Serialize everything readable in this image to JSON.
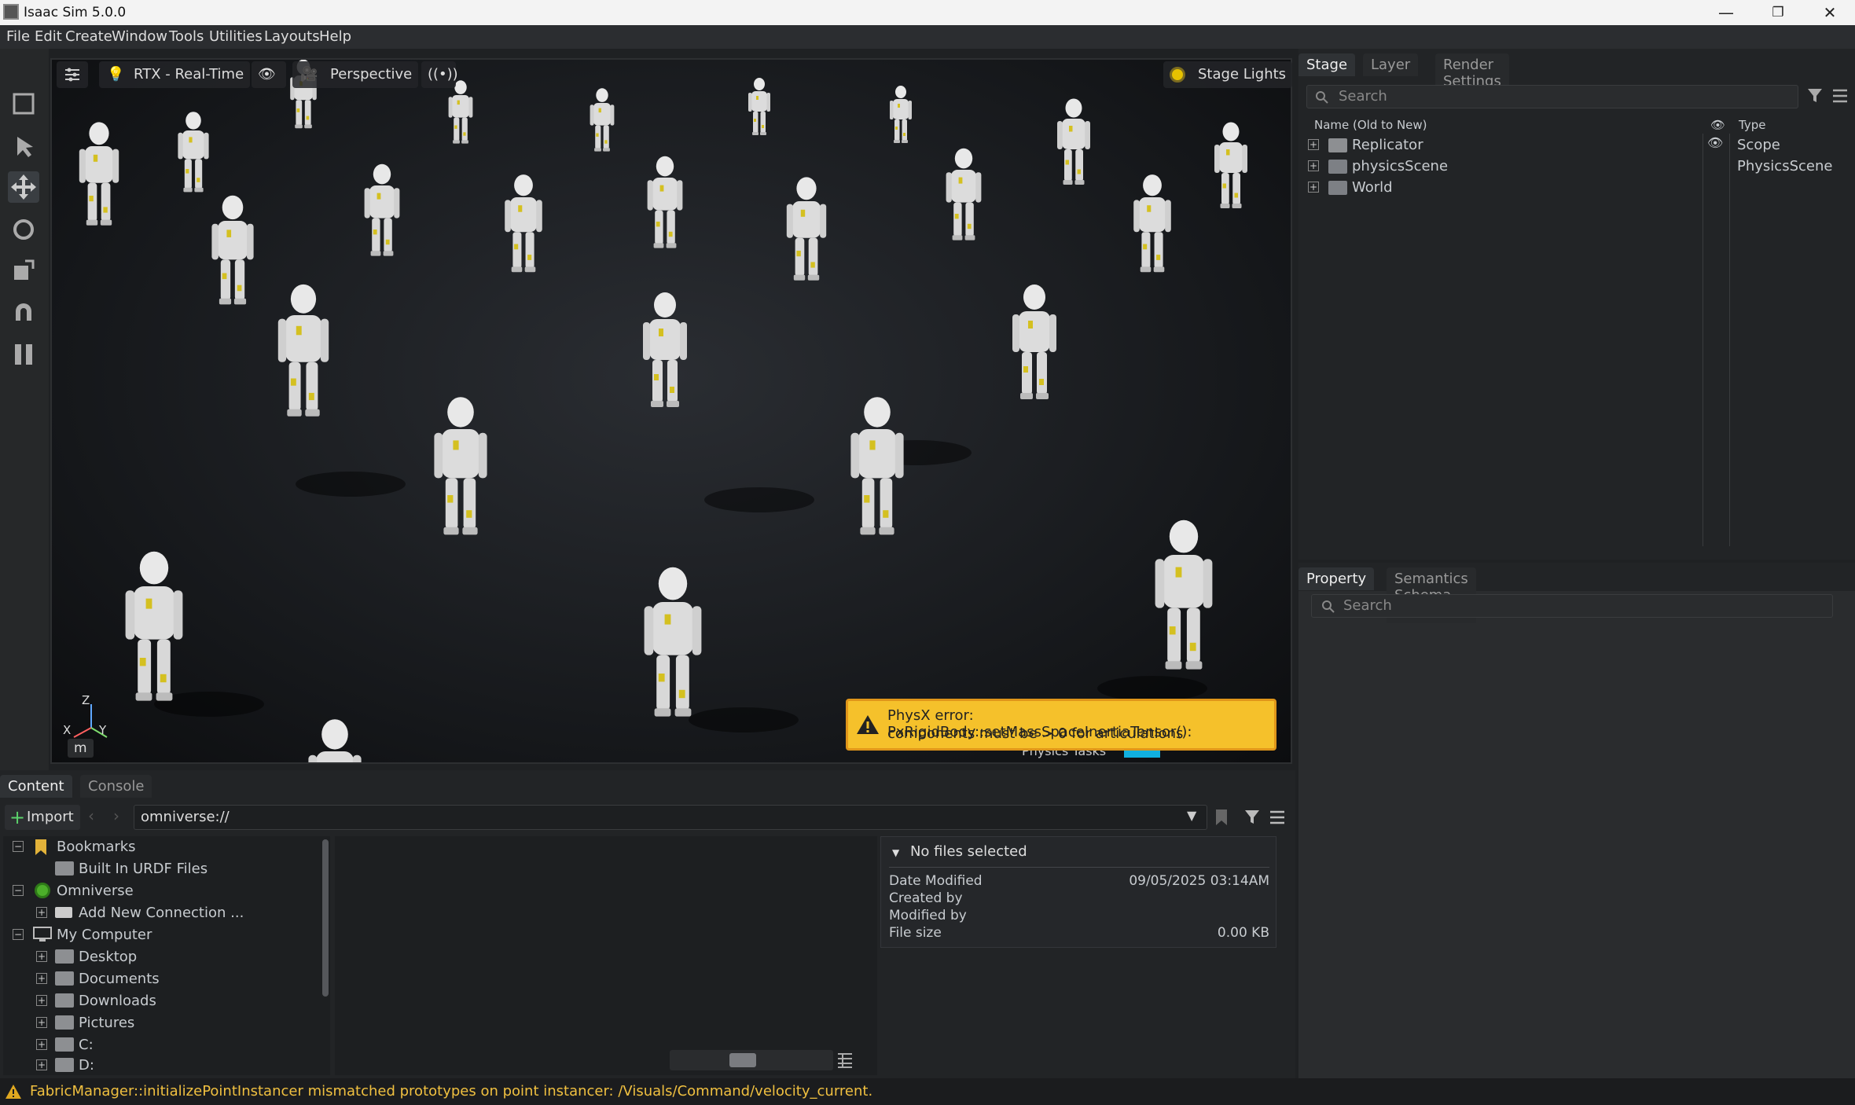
{
  "window": {
    "title": "Isaac Sim 5.0.0",
    "minimize": "—",
    "maximize": "❐",
    "close": "✕"
  },
  "menu": [
    "File",
    "Edit",
    "Create",
    "Window",
    "Tools",
    "Utilities",
    "Layouts",
    "Help"
  ],
  "viewport": {
    "render_mode": "RTX - Real-Time",
    "camera": "Perspective",
    "lights": "Stage Lights",
    "unit": "m",
    "axis_z": "Z",
    "axis_x": "X",
    "axis_y": "Y",
    "physics_tasks": "Physics Tasks",
    "warning": {
      "line1": "PhysX error: PxRigidBody::setMassSpaceInertiaTensor():",
      "line2": "components must be > 0 for articulations"
    }
  },
  "stage": {
    "tabs": [
      "Stage",
      "Layer",
      "Render Settings"
    ],
    "search_placeholder": "Search",
    "col_name": "Name (Old to New)",
    "col_type": "Type",
    "items": [
      {
        "name": "Replicator",
        "type": "Scope"
      },
      {
        "name": "physicsScene",
        "type": "PhysicsScene"
      },
      {
        "name": "World",
        "type": ""
      }
    ]
  },
  "property": {
    "tabs": [
      "Property",
      "Semantics Schema Editor"
    ],
    "search_placeholder": "Search"
  },
  "content": {
    "tabs": [
      "Content",
      "Console"
    ],
    "import_label": "Import",
    "path": "omniverse://",
    "tree": [
      {
        "label": "Bookmarks"
      },
      {
        "label": "Built In URDF Files"
      },
      {
        "label": "Omniverse"
      },
      {
        "label": "Add New Connection ..."
      },
      {
        "label": "My Computer"
      },
      {
        "label": "Desktop"
      },
      {
        "label": "Documents"
      },
      {
        "label": "Downloads"
      },
      {
        "label": "Pictures"
      },
      {
        "label": "C:"
      },
      {
        "label": "D:"
      }
    ],
    "info": {
      "header": "No files selected",
      "date_modified_label": "Date Modified",
      "date_modified": "09/05/2025 03:14AM",
      "created_by_label": "Created by",
      "modified_by_label": "Modified by",
      "file_size_label": "File size",
      "file_size": "0.00 KB"
    }
  },
  "status": {
    "message": "FabricManager::initializePointInstancer mismatched prototypes on point instancer: /Visuals/Command/velocity_current."
  }
}
